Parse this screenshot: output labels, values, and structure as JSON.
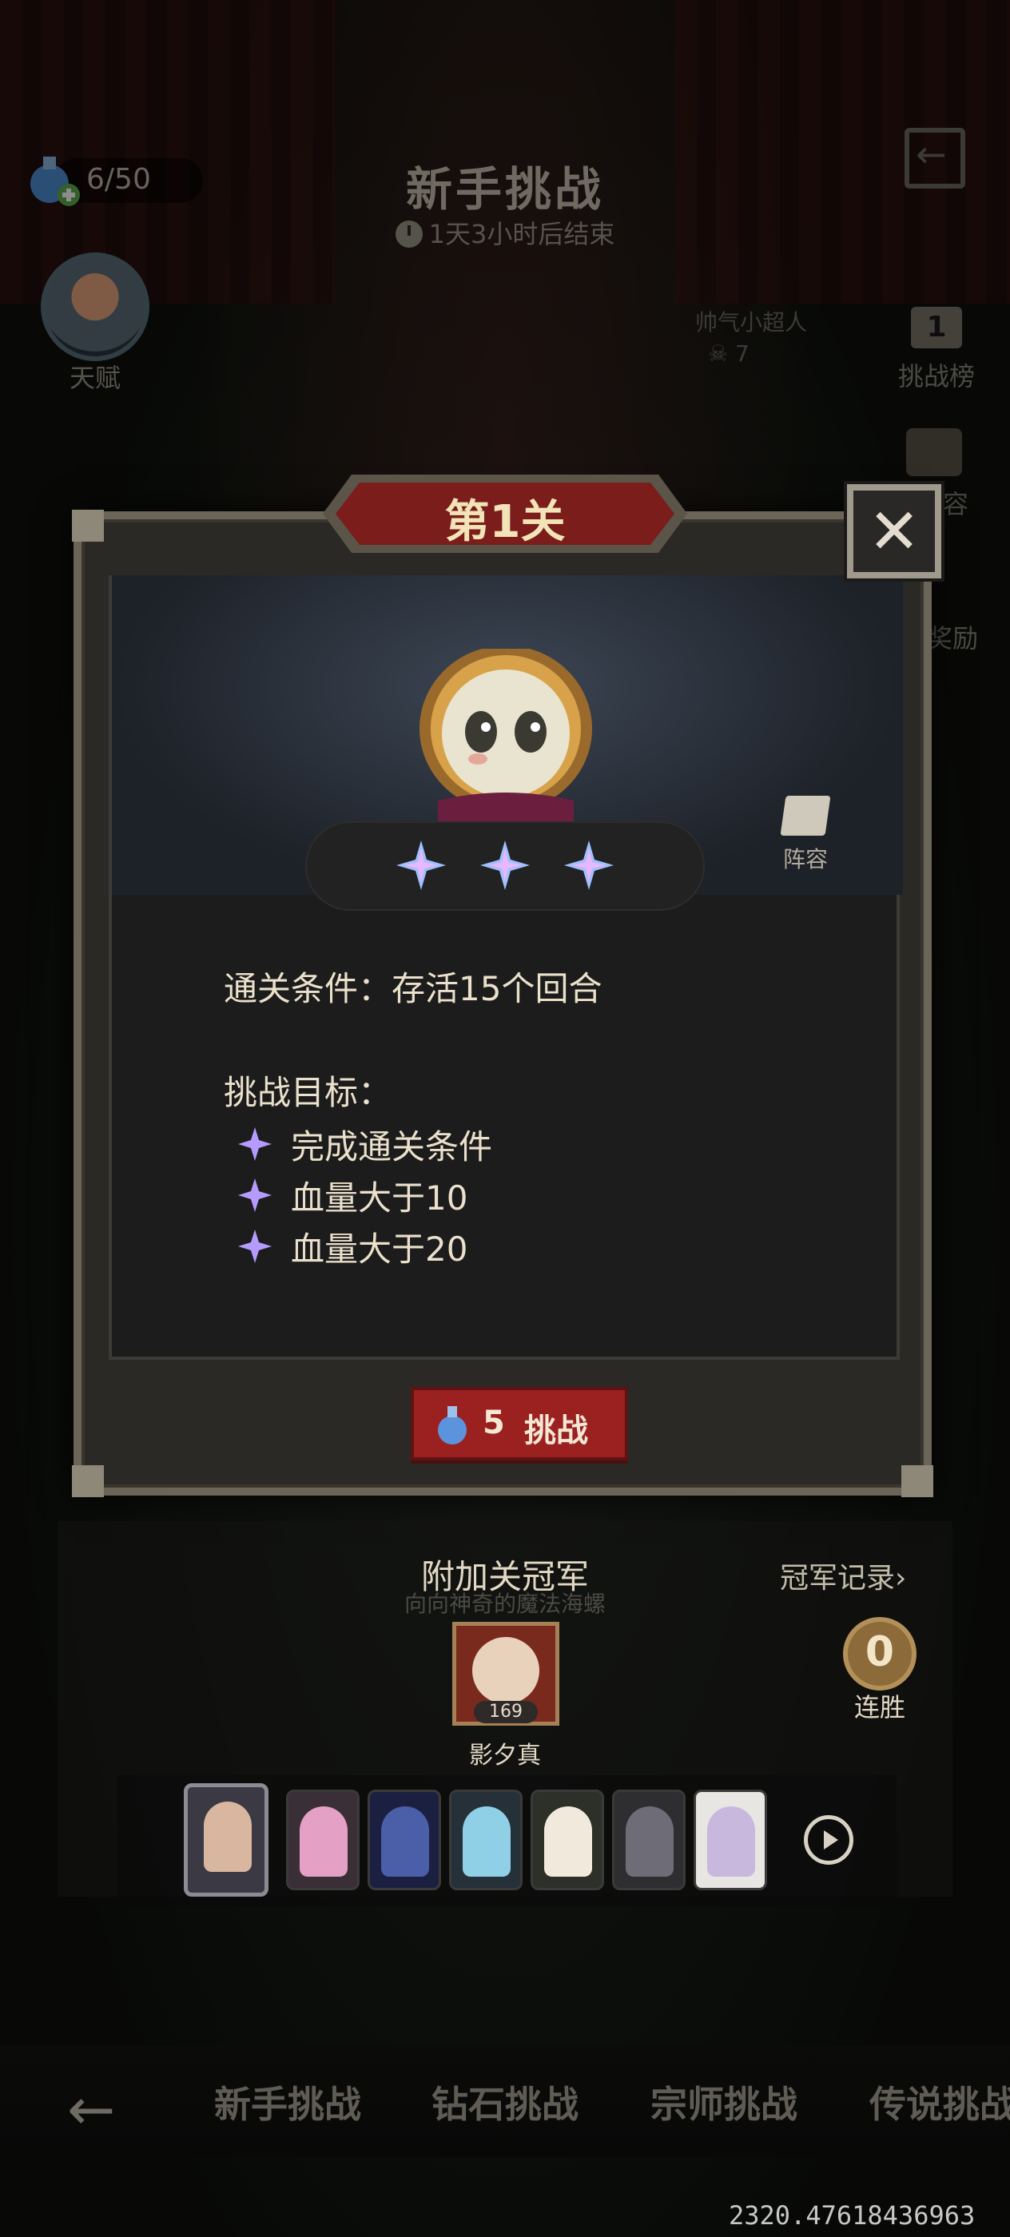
{
  "header": {
    "energy": "6/50",
    "title": "新手挑战",
    "timer": "1天3小时后结束",
    "talent_label": "天赋",
    "board_player": "帅气小超人",
    "board_skulls": "7",
    "rank_number": "1",
    "rank_label": "挑战榜",
    "side2_label": "容",
    "side3_label": "奖励"
  },
  "dialog": {
    "level": "第1关",
    "close_glyph": "✕",
    "lineup_label": "阵容",
    "condition": "通关条件：存活15个回合",
    "goals_title": "挑战目标：",
    "goals": [
      "完成通关条件",
      "血量大于10",
      "血量大于20"
    ],
    "challenge_cost": "5",
    "challenge_label": "挑战"
  },
  "champion": {
    "title": "附加关冠军",
    "subtitle": "向向神奇的魔法海螺",
    "record_link": "冠军记录›",
    "level": "169",
    "name": "影夕真",
    "streak_value": "0",
    "streak_label": "连胜"
  },
  "team": {
    "heroes": [
      {
        "name": "hero-1",
        "color": "#d9b6a0"
      },
      {
        "name": "hero-2",
        "color": "#e5a0c6"
      },
      {
        "name": "hero-3",
        "color": "#4a5fa8"
      },
      {
        "name": "hero-4",
        "color": "#8fd0e6"
      },
      {
        "name": "hero-5",
        "color": "#f1eadc"
      },
      {
        "name": "hero-6",
        "color": "#6e6c77"
      },
      {
        "name": "hero-7",
        "color": "#c9b8de"
      }
    ]
  },
  "nav": {
    "tabs": [
      "新手挑战",
      "钻石挑战",
      "宗师挑战",
      "传说挑战"
    ],
    "back_glyph": "←"
  },
  "debug_coords": "2320.47618436963",
  "colors": {
    "accent_red": "#9b2020",
    "frame": "#6b6558",
    "text": "#eae0cb",
    "star_gradient": [
      "#9bdcff",
      "#c39bff",
      "#ffb6e6"
    ]
  }
}
